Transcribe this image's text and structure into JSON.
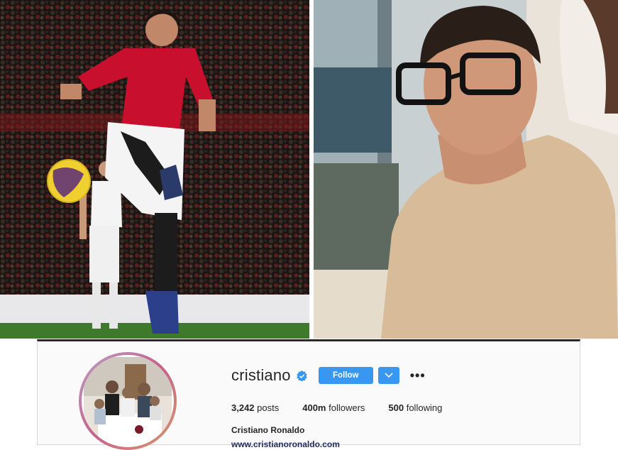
{
  "profile": {
    "username": "cristiano",
    "verified": true,
    "follow_label": "Follow",
    "more_label": "•••",
    "stats": [
      {
        "value": "3,242",
        "label": "posts"
      },
      {
        "value": "400m",
        "label": "followers"
      },
      {
        "value": "500",
        "label": "following"
      }
    ],
    "full_name": "Cristiano Ronaldo",
    "website": "www.cristianoronaldo.com"
  },
  "colors": {
    "follow_blue": "#3897f0",
    "verified_blue": "#3897f0",
    "text_dark": "#262626",
    "jersey_red": "#c8102e"
  },
  "icons": {
    "verified": "verified-badge-icon",
    "dropdown": "chevron-down-icon",
    "more": "more-options-icon"
  }
}
